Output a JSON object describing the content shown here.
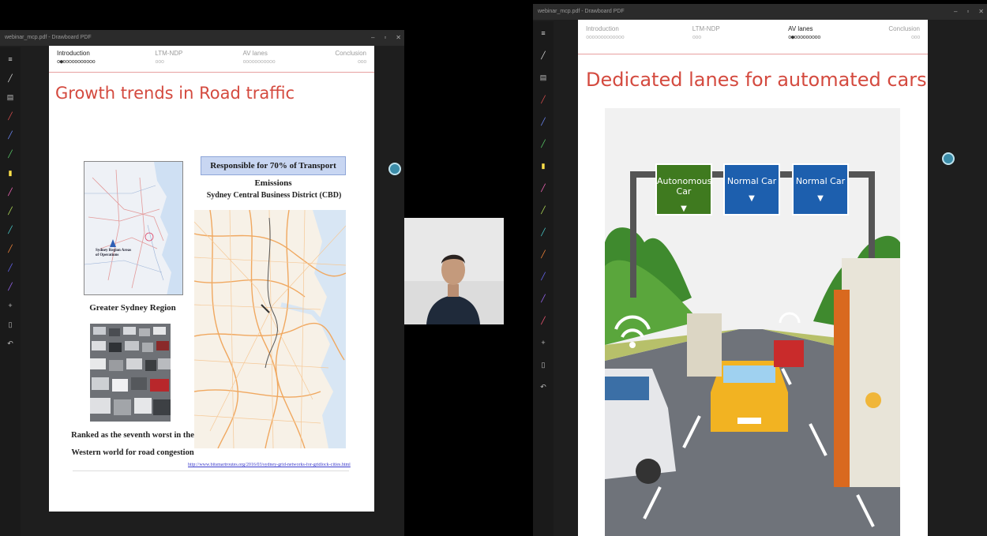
{
  "left_window": {
    "title": "webinar_mcp.pdf - Drawboard PDF",
    "controls": [
      "–",
      "▫",
      "✕"
    ],
    "nav": [
      {
        "label": "Introduction",
        "dots": "o●ooooooooooo",
        "active": true
      },
      {
        "label": "LTM-NDP",
        "dots": "ooo",
        "active": false
      },
      {
        "label": "AV lanes",
        "dots": "ooooooooooo",
        "active": false
      },
      {
        "label": "Conclusion",
        "dots": "ooo",
        "active": false
      }
    ],
    "slide_title": "Growth trends in Road traffic",
    "map_inset_label": "Sydney Region Areas of Operations",
    "greater_sydney_caption": "Greater Sydney Region",
    "emissions_box": "Responsible for 70% of Transport Emissions",
    "cbd_caption": "Sydney Central Business District (CBD)",
    "congestion_caption_line1": "Ranked as the seventh worst in the",
    "congestion_caption_line2": "Western world for road congestion",
    "source_link": "http://www.bitsmartroutes.org/2016/03/sydney-grid-networks-for-gridlock-cities.html"
  },
  "right_window": {
    "title": "webinar_mcp.pdf - Drawboard PDF",
    "controls": [
      "–",
      "▫",
      "✕"
    ],
    "nav": [
      {
        "label": "Introduction",
        "dots": "ooooooooooooo",
        "active": false
      },
      {
        "label": "LTM-NDP",
        "dots": "ooo",
        "active": false
      },
      {
        "label": "AV lanes",
        "dots": "o●ooooooooo",
        "active": true
      },
      {
        "label": "Conclusion",
        "dots": "ooo",
        "active": false
      }
    ],
    "slide_title": "Dedicated lanes for automated cars",
    "signs": [
      {
        "label": "Autonomous Car",
        "color": "#3f7a1f"
      },
      {
        "label": "Normal Car",
        "color": "#1d5fae"
      },
      {
        "label": "Normal Car",
        "color": "#1d5fae"
      }
    ]
  },
  "colors": {
    "accent_title": "#d44a3f",
    "nav_rule": "#e7a0a0",
    "fab": "#3b8ca8"
  },
  "icons": [
    "pen-icon",
    "highlighter-icon",
    "eraser-icon",
    "plus-icon",
    "undo-icon",
    "settings-icon",
    "fab-icon"
  ]
}
